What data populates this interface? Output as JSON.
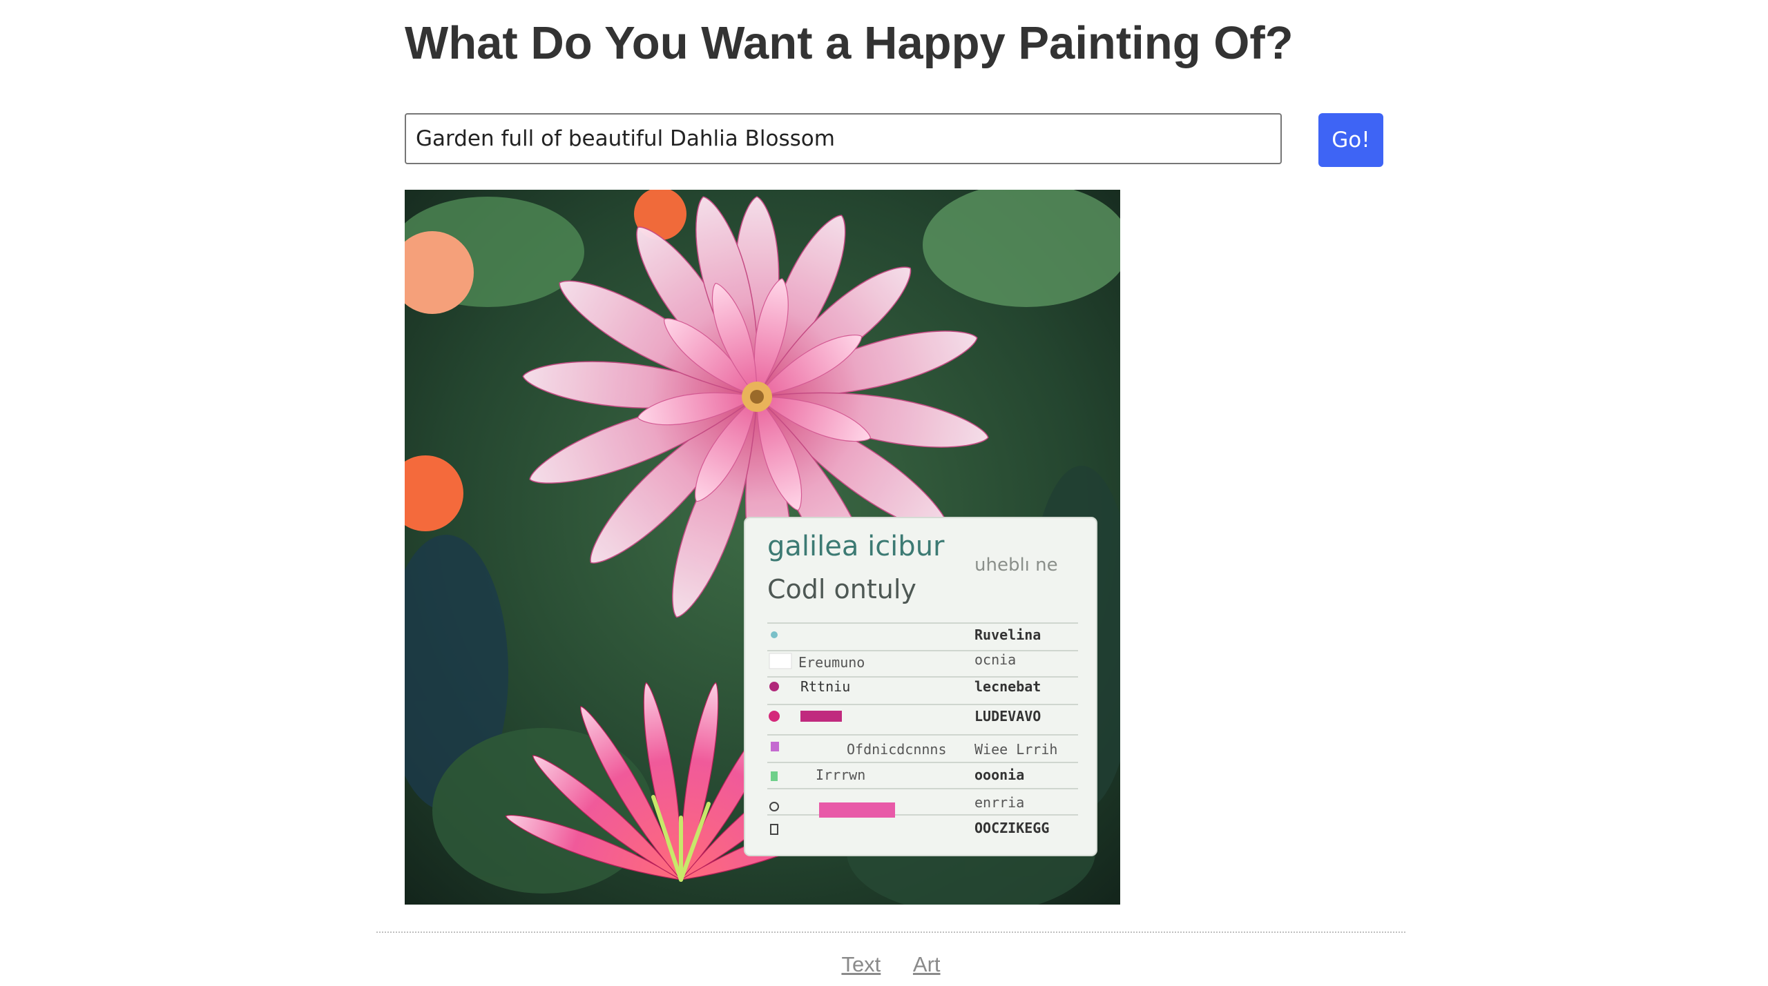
{
  "page": {
    "title": "What Do You Want a Happy Painting Of?"
  },
  "prompt": {
    "value": "Garden full of beautiful Dahlia Blossom"
  },
  "actions": {
    "go_label": "Go!"
  },
  "artwork": {
    "card_heading": "galilea icibur",
    "card_subheading": "Codl ontuly",
    "card_tag": "uheblı ne",
    "card_rows": [
      {
        "left": "",
        "right": "Ruvelina"
      },
      {
        "left": "Ereumuno",
        "right": "ocnia"
      },
      {
        "left": "Rttniu",
        "right": "lecnebat"
      },
      {
        "left": "",
        "right": "LUDEVAVO"
      },
      {
        "left": "Ofdnicdcnnns",
        "right": "Wiee Lrrih"
      },
      {
        "left": "Irrrwn",
        "right": "ooonia"
      },
      {
        "left": "",
        "right": "enrria"
      },
      {
        "left": "",
        "right": "OOCZIKEGG"
      }
    ]
  },
  "footer": {
    "links": [
      "Text",
      "Art"
    ]
  },
  "colors": {
    "accent": "#3e64f5",
    "title": "#333333",
    "link": "#8a8a8a"
  }
}
